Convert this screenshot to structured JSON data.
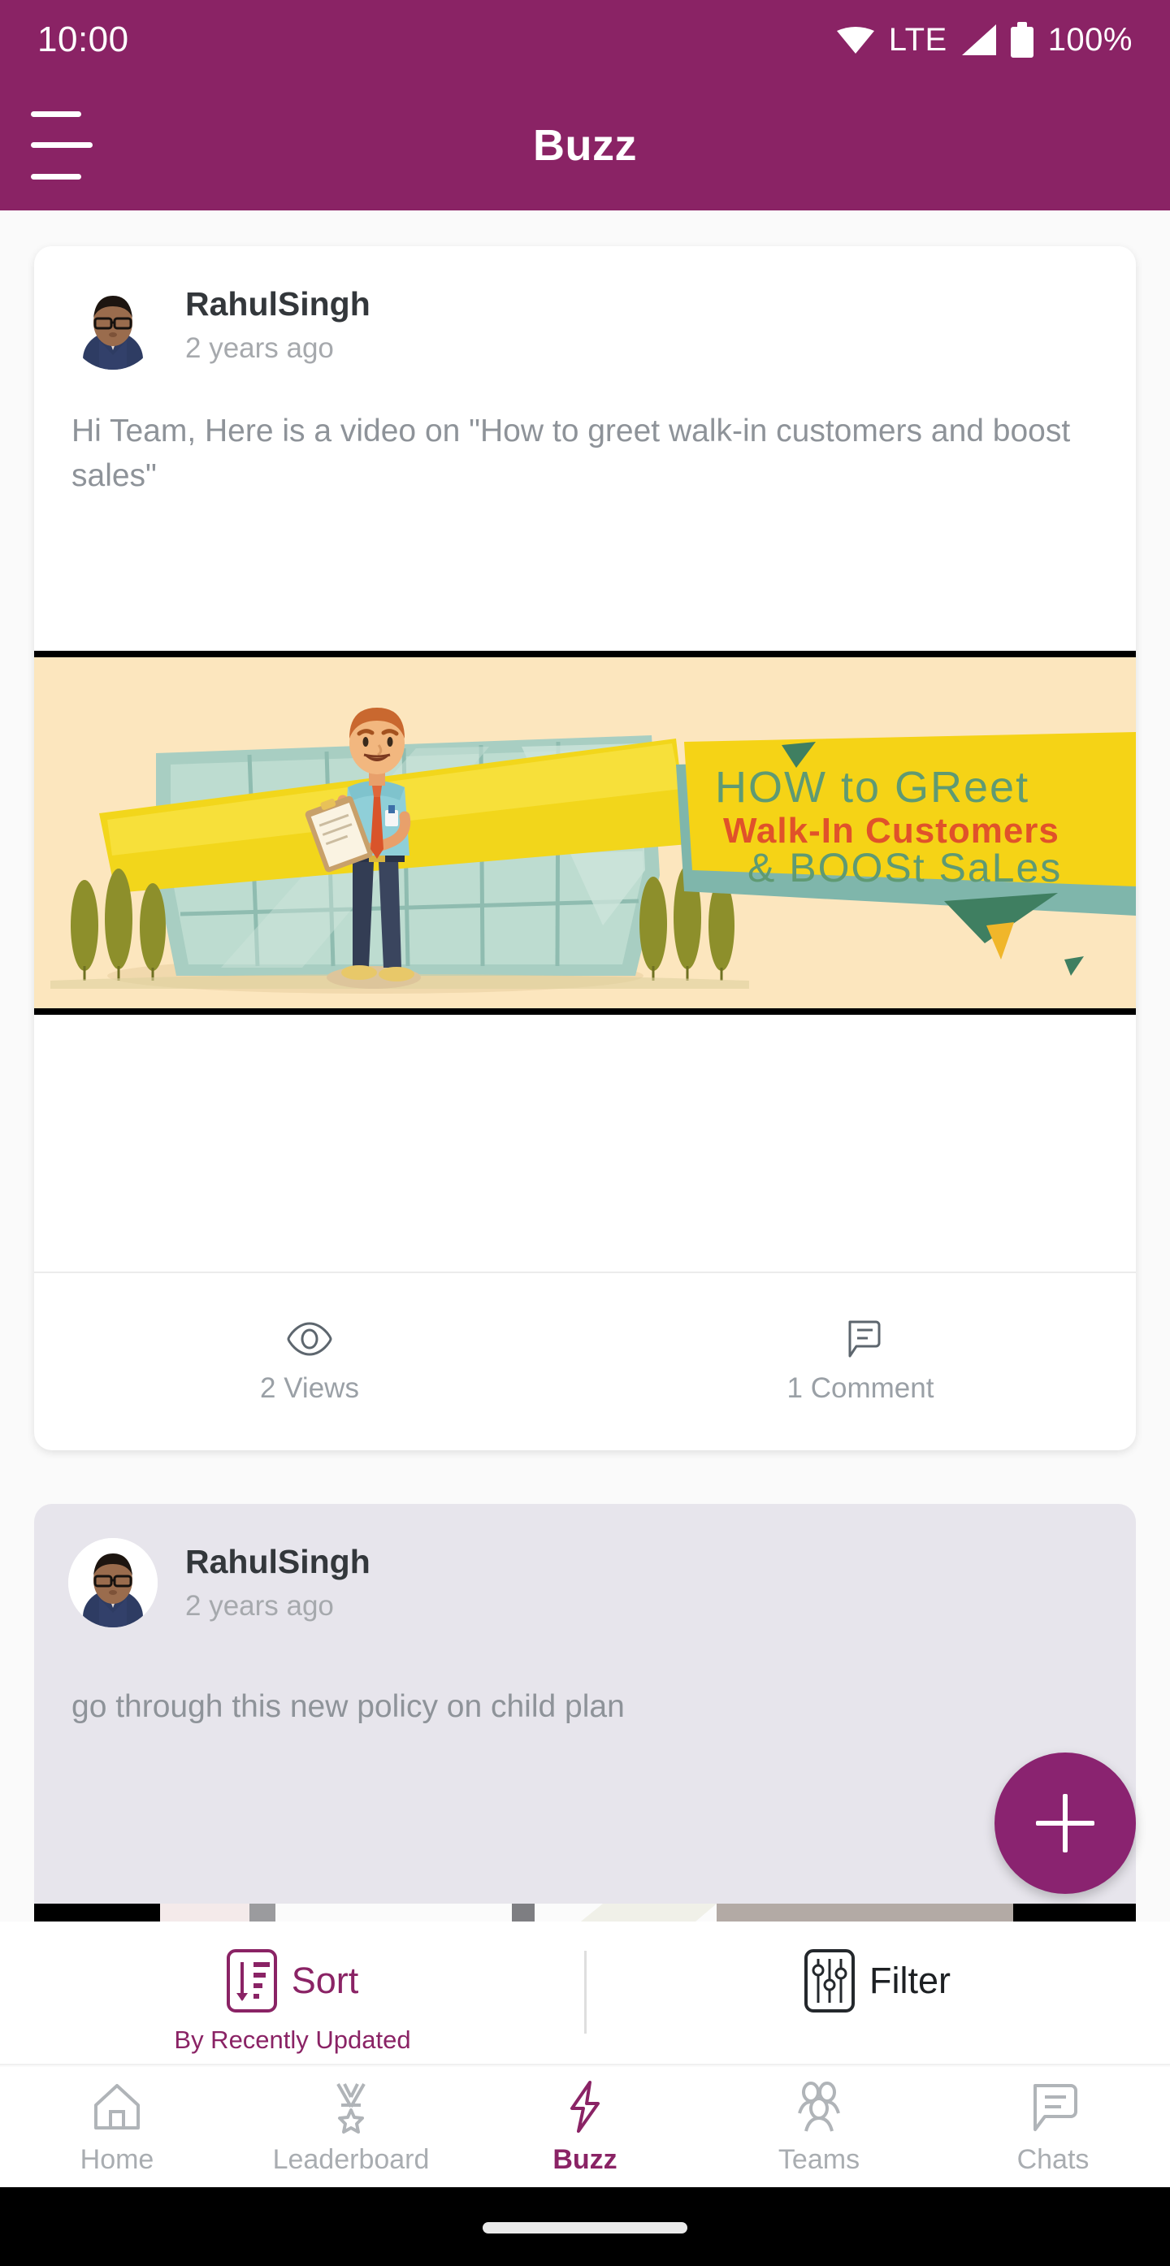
{
  "status_bar": {
    "time": "10:00",
    "network_label": "LTE",
    "battery_percent": "100%",
    "wifi_icon": "wifi-icon",
    "signal_icon": "signal-icon",
    "battery_icon": "battery-icon"
  },
  "app_bar": {
    "title": "Buzz",
    "menu_icon": "hamburger-menu-icon"
  },
  "theme": {
    "brand_purple": "#8a2365",
    "fab_purple": "#8a2370",
    "muted_text": "#8e9399",
    "card_alt_bg": "#e7e5ec"
  },
  "feed": {
    "posts": [
      {
        "author": "RahulSingh",
        "time": "2 years ago",
        "text": "Hi Team, Here is a video on \"How to greet walk-in customers and boost sales\"",
        "media_type": "video",
        "media": {
          "banner_line1": "HOW to GReet",
          "banner_line2": "Walk-In Customers",
          "banner_line3": "& BOOSt SaLes",
          "bg_color": "#fce6be",
          "banner_color": "#f5d316",
          "line1_color": "#5f9a73",
          "line2_color": "#e0522a",
          "line3_color": "#5f9a73"
        },
        "stats": [
          {
            "icon": "eye-icon",
            "label": "2 Views"
          },
          {
            "icon": "comment-icon",
            "label": "1 Comment"
          }
        ]
      },
      {
        "author": "RahulSingh",
        "time": "2 years ago",
        "text": "go through this  new policy on child plan",
        "media_type": "image"
      }
    ]
  },
  "fab": {
    "name": "create-post-button",
    "icon": "plus-icon"
  },
  "sort_filter": {
    "sort": {
      "label": "Sort",
      "sublabel": "By Recently Updated",
      "icon": "sort-descending-icon"
    },
    "filter": {
      "label": "Filter",
      "icon": "filter-sliders-icon"
    }
  },
  "bottom_nav": {
    "items": [
      {
        "label": "Home",
        "icon": "home-icon",
        "active": false
      },
      {
        "label": "Leaderboard",
        "icon": "medal-icon",
        "active": false
      },
      {
        "label": "Buzz",
        "icon": "lightning-icon",
        "active": true
      },
      {
        "label": "Teams",
        "icon": "people-icon",
        "active": false
      },
      {
        "label": "Chats",
        "icon": "chat-bubble-icon",
        "active": false
      }
    ]
  }
}
